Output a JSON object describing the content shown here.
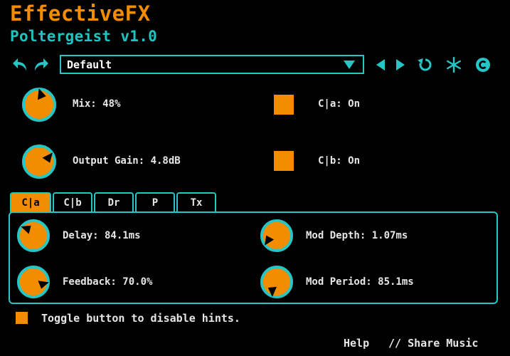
{
  "header": {
    "title": "EffectiveFX",
    "subtitle": "Poltergeist v1.0"
  },
  "toolbar": {
    "preset_value": "Default",
    "icons": [
      "undo-icon",
      "redo-icon",
      "chevron-down-icon",
      "previous-icon",
      "next-icon",
      "reset-icon",
      "randomize-icon",
      "copyright-icon"
    ]
  },
  "controls": {
    "mix": {
      "label": "Mix: 48%",
      "value": 0.48
    },
    "output_gain": {
      "label": "Output Gain: 4.8dB"
    },
    "ca_toggle": {
      "label": "C|a: On"
    },
    "cb_toggle": {
      "label": "C|b: On"
    }
  },
  "tabs": [
    {
      "label": "C|a",
      "active": true
    },
    {
      "label": "C|b",
      "active": false
    },
    {
      "label": "Dr",
      "active": false
    },
    {
      "label": "P",
      "active": false
    },
    {
      "label": "Tx",
      "active": false
    }
  ],
  "panel": {
    "delay": {
      "label": "Delay: 84.1ms"
    },
    "feedback": {
      "label": "Feedback: 70.0%",
      "value": 0.7
    },
    "mod_depth": {
      "label": "Mod Depth: 1.07ms"
    },
    "mod_period": {
      "label": "Mod Period: 85.1ms"
    }
  },
  "hint": {
    "text": "Toggle button to disable hints."
  },
  "footer": {
    "help": "Help",
    "share": "// Share Music"
  },
  "colors": {
    "accent": "#f28d00",
    "teal": "#26c6c6",
    "background": "#000000"
  }
}
